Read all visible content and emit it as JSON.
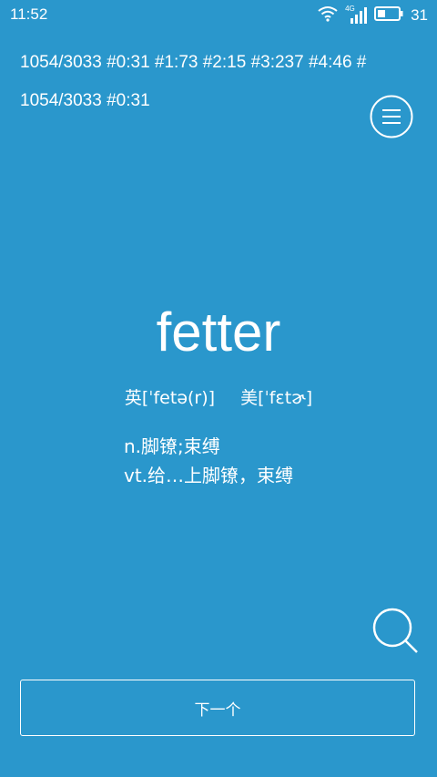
{
  "status_bar": {
    "time": "11:52",
    "network": "4G",
    "battery": "31",
    "icons": [
      "wifi-icon",
      "signal-icon",
      "battery-icon"
    ]
  },
  "ticker": {
    "text": "1054/3033  #0:31 #1:73 #2:15 #3:237 #4:46 #"
  },
  "progress": {
    "counter": "1054/3033 #0:31"
  },
  "word": {
    "headword": "fetter",
    "phonetic_uk": "英[ˈfetə(r)]",
    "phonetic_us": "美[ˈfɛtɚ]",
    "definitions": [
      "n.脚镣;束缚",
      "vt.给…上脚镣，束缚"
    ]
  },
  "actions": {
    "next_label": "下一个"
  },
  "colors": {
    "background": "#2a97cc",
    "foreground": "#ffffff"
  }
}
